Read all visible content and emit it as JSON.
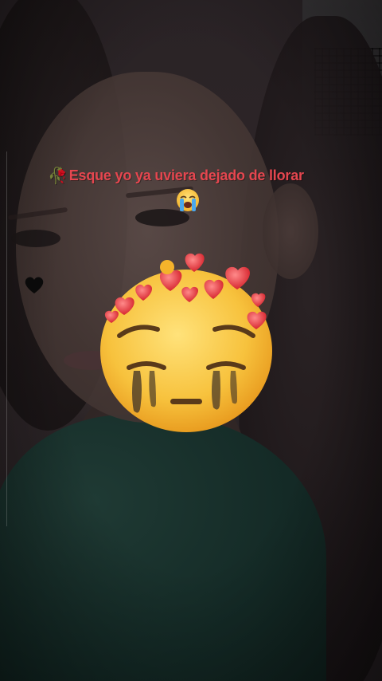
{
  "caption": {
    "text": "Esque yo  ya  uviera  dejado de llorar",
    "lead_icon": "wilted-rose-icon",
    "trail_icon": "loudly-crying-face-icon",
    "color": "#e5464f"
  },
  "stickers": {
    "black_heart": {
      "icon": "black-heart-icon"
    },
    "main_emoji": {
      "icon": "pleading-crying-face-with-hearts-icon"
    }
  }
}
